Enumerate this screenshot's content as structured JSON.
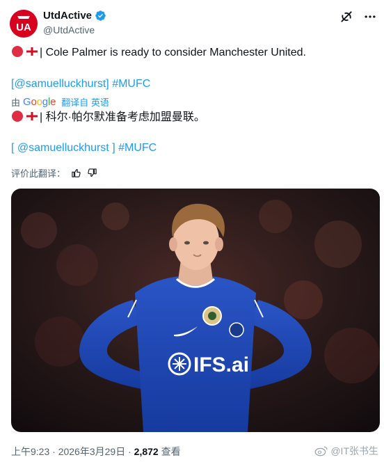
{
  "author": {
    "display_name": "UtdActive",
    "handle": "@UtdActive",
    "avatar_text": "UA",
    "verified": true
  },
  "tweet": {
    "text_original_suffix": "| Cole Palmer is ready to consider Manchester United.",
    "tags_original": {
      "open": "[",
      "mention": "@samuelluckhurst",
      "close": "]",
      "hashtag": "#MUFC"
    },
    "translated_by_prefix": "由",
    "translated_by_service": "Google",
    "translated_by_suffix": "翻译自 英语",
    "text_translated_suffix": "| 科尔·帕尔默准备考虑加盟曼联。",
    "tags_translated": {
      "open": "[",
      "mention": "@samuelluckhurst",
      "close": "]",
      "hashtag": "#MUFC"
    },
    "rate_translation_label": "评价此翻译：",
    "flag_icons": [
      "red-circle-icon",
      "england-flag-icon"
    ]
  },
  "meta": {
    "time": "上午9:23",
    "separator": "·",
    "date": "2026年3月29日",
    "views_count": "2,872",
    "views_label": "查看"
  },
  "watermark": {
    "text": "@IT张书生"
  },
  "colors": {
    "link": "#1d9bf0",
    "secondary_text": "#536471",
    "avatar_bg": "#d8001f",
    "jersey_blue": "#1a3fa8"
  }
}
